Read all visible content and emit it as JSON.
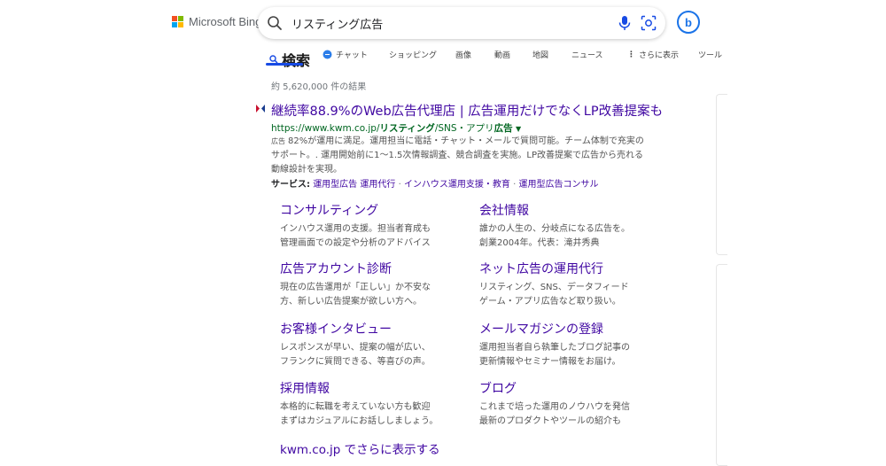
{
  "brand": {
    "name": "Microsoft Bing",
    "colors": [
      "#f25022",
      "#7fba00",
      "#00a4ef",
      "#ffb900"
    ]
  },
  "search": {
    "query": "リスティング広告"
  },
  "copilot": {
    "glyph": "b"
  },
  "tabs": [
    {
      "label": "検索",
      "icon": "search-icon",
      "active": true
    },
    {
      "label": "チャット",
      "icon": "chat-icon"
    },
    {
      "label": "ショッピング"
    },
    {
      "label": "画像"
    },
    {
      "label": "動画"
    },
    {
      "label": "地図"
    },
    {
      "label": "ニュース"
    },
    {
      "label": "さらに表示",
      "icon": "more-icon"
    },
    {
      "label": "ツール"
    }
  ],
  "results": {
    "count": "約 5,620,000 件の結果",
    "ad": {
      "title": "継続率88.9%のWeb広告代理店 | 広告運用だけでなくLP改善提案も",
      "url_prefix": "https://www.kwm.co.jp/",
      "url_bold": "リスティング",
      "url_mid": "/SNS・アプリ",
      "url_bold2": "広告",
      "badge": "広告",
      "description": "82%が運用に満足。運用担当に電話・チャット・メールで質問可能。チーム体制で充実のサポート。. 運用開始前に1〜1.5次情報調査、競合調査を実施。LP改善提案で広告から売れる動線設計を実現。",
      "services_label": "サービス:",
      "services": [
        "運用型広告 運用代行",
        "インハウス運用支援・教育",
        "運用型広告コンサル"
      ]
    },
    "sitelinks": [
      {
        "title": "コンサルティング",
        "desc1": "インハウス運用の支援。担当者育成も",
        "desc2": "管理画面での設定や分析のアドバイス"
      },
      {
        "title": "会社情報",
        "desc1": "誰かの人生の、分岐点になる広告を。",
        "desc2": "創業2004年。代表：滝井秀典"
      },
      {
        "title": "広告アカウント診断",
        "desc1": "現在の広告運用が「正しい」か不安な",
        "desc2": "方、新しい広告提案が欲しい方へ。"
      },
      {
        "title": "ネット広告の運用代行",
        "desc1": "リスティング、SNS、データフィード",
        "desc2": "ゲーム・アプリ広告など取り扱い。"
      },
      {
        "title": "お客様インタビュー",
        "desc1": "レスポンスが早い、提案の幅が広い、",
        "desc2": "フランクに質問できる、等喜びの声。"
      },
      {
        "title": "メールマガジンの登録",
        "desc1": "運用担当者自ら執筆したブログ記事の",
        "desc2": "更新情報やセミナー情報をお届け。"
      },
      {
        "title": "採用情報",
        "desc1": "本格的に転職を考えていない方も歓迎",
        "desc2": "まずはカジュアルにお話ししましょう。"
      },
      {
        "title": "ブログ",
        "desc1": "これまで培った運用のノウハウを発信",
        "desc2": "最新のプロダクトやツールの紹介も"
      }
    ],
    "more_link": "kwm.co.jp でさらに表示する"
  }
}
